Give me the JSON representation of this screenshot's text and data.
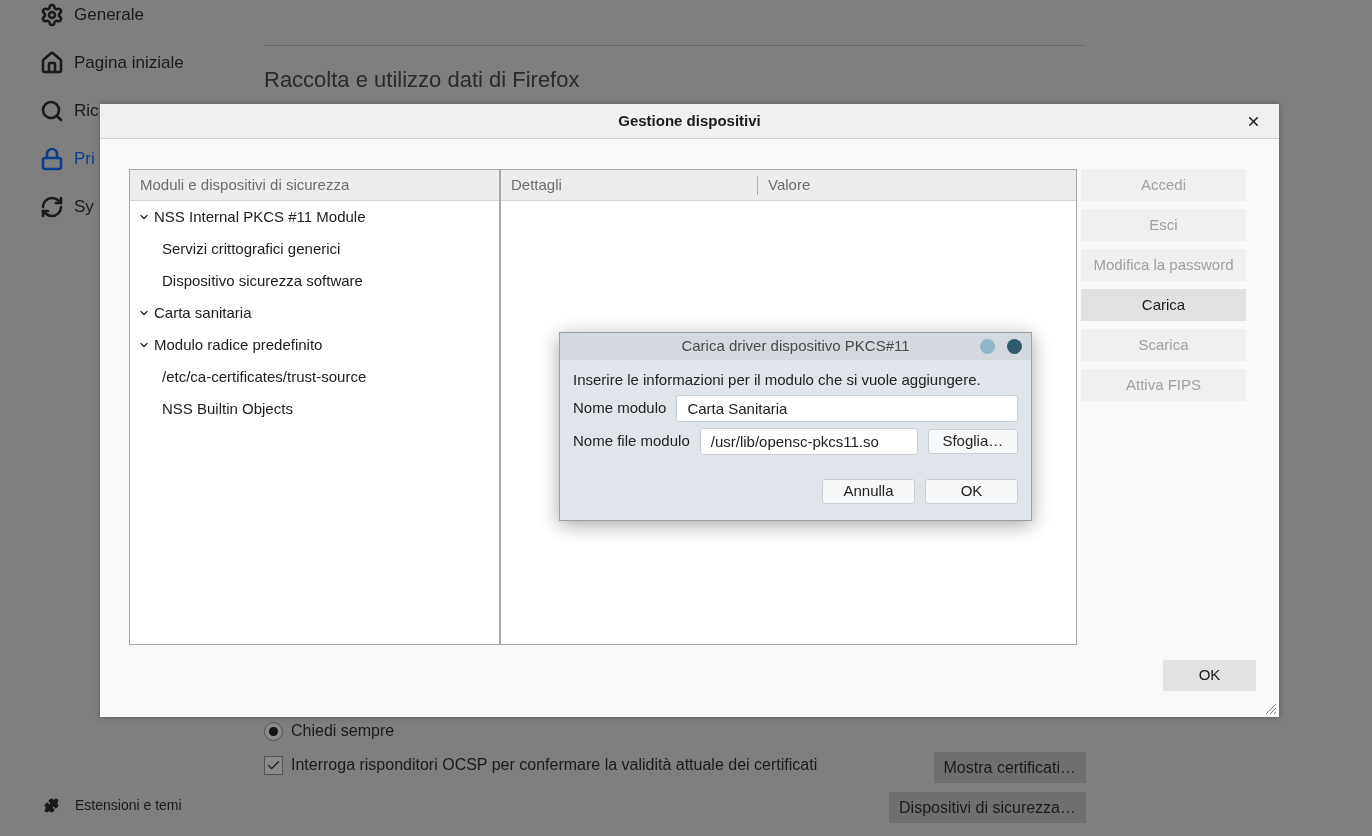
{
  "sidebar": {
    "items": [
      {
        "label": "Generale",
        "selected": false
      },
      {
        "label": "Pagina iniziale",
        "selected": false
      },
      {
        "label": "Ric",
        "selected": false
      },
      {
        "label": "Pri",
        "selected": true
      },
      {
        "label": "Sy",
        "selected": false
      }
    ],
    "footer": "Estensioni e temi"
  },
  "content": {
    "heading": "Raccolta e utilizzo dati di Firefox",
    "radio": {
      "label": "Chiedi sempre",
      "selected": true
    },
    "checkbox": {
      "label": "Interroga risponditori OCSP per confermare la validità attuale dei certificati",
      "checked": true
    },
    "buttons": [
      {
        "label": "Mostra certificati…"
      },
      {
        "label": "Dispositivi di sicurezza…"
      }
    ]
  },
  "device_manager": {
    "title": "Gestione dispositivi",
    "tree": {
      "column": "Moduli e dispositivi di sicurezza",
      "items": [
        {
          "label": "NSS Internal PKCS #11 Module",
          "expanded": true,
          "children": [
            {
              "label": "Servizi crittografici generici"
            },
            {
              "label": "Dispositivo sicurezza software"
            }
          ]
        },
        {
          "label": "Carta sanitaria",
          "expanded": true
        },
        {
          "label": "Modulo radice predefinito",
          "expanded": true,
          "children": [
            {
              "label": "/etc/ca-certificates/trust-source"
            },
            {
              "label": "NSS Builtin Objects"
            }
          ]
        }
      ]
    },
    "details": {
      "columns": [
        "Dettagli",
        "Valore"
      ]
    },
    "buttons": [
      {
        "label": "Accedi",
        "disabled": true
      },
      {
        "label": "Esci",
        "disabled": true
      },
      {
        "label": "Modifica la password",
        "disabled": true
      },
      {
        "label": "Carica",
        "disabled": false
      },
      {
        "label": "Scarica",
        "disabled": true
      },
      {
        "label": "Attiva FIPS",
        "disabled": true
      }
    ],
    "ok": "OK"
  },
  "load_dialog": {
    "title": "Carica driver dispositivo PKCS#11",
    "prompt": "Inserire le informazioni per il modulo che si vuole aggiungere.",
    "fields": [
      {
        "label": "Nome modulo",
        "value": "Carta Sanitaria"
      },
      {
        "label": "Nome file modulo",
        "value": "/usr/lib/opensc-pkcs11.so"
      }
    ],
    "browse": {
      "label": "Sfoglia…"
    },
    "buttons": [
      "Annulla",
      "OK"
    ]
  }
}
